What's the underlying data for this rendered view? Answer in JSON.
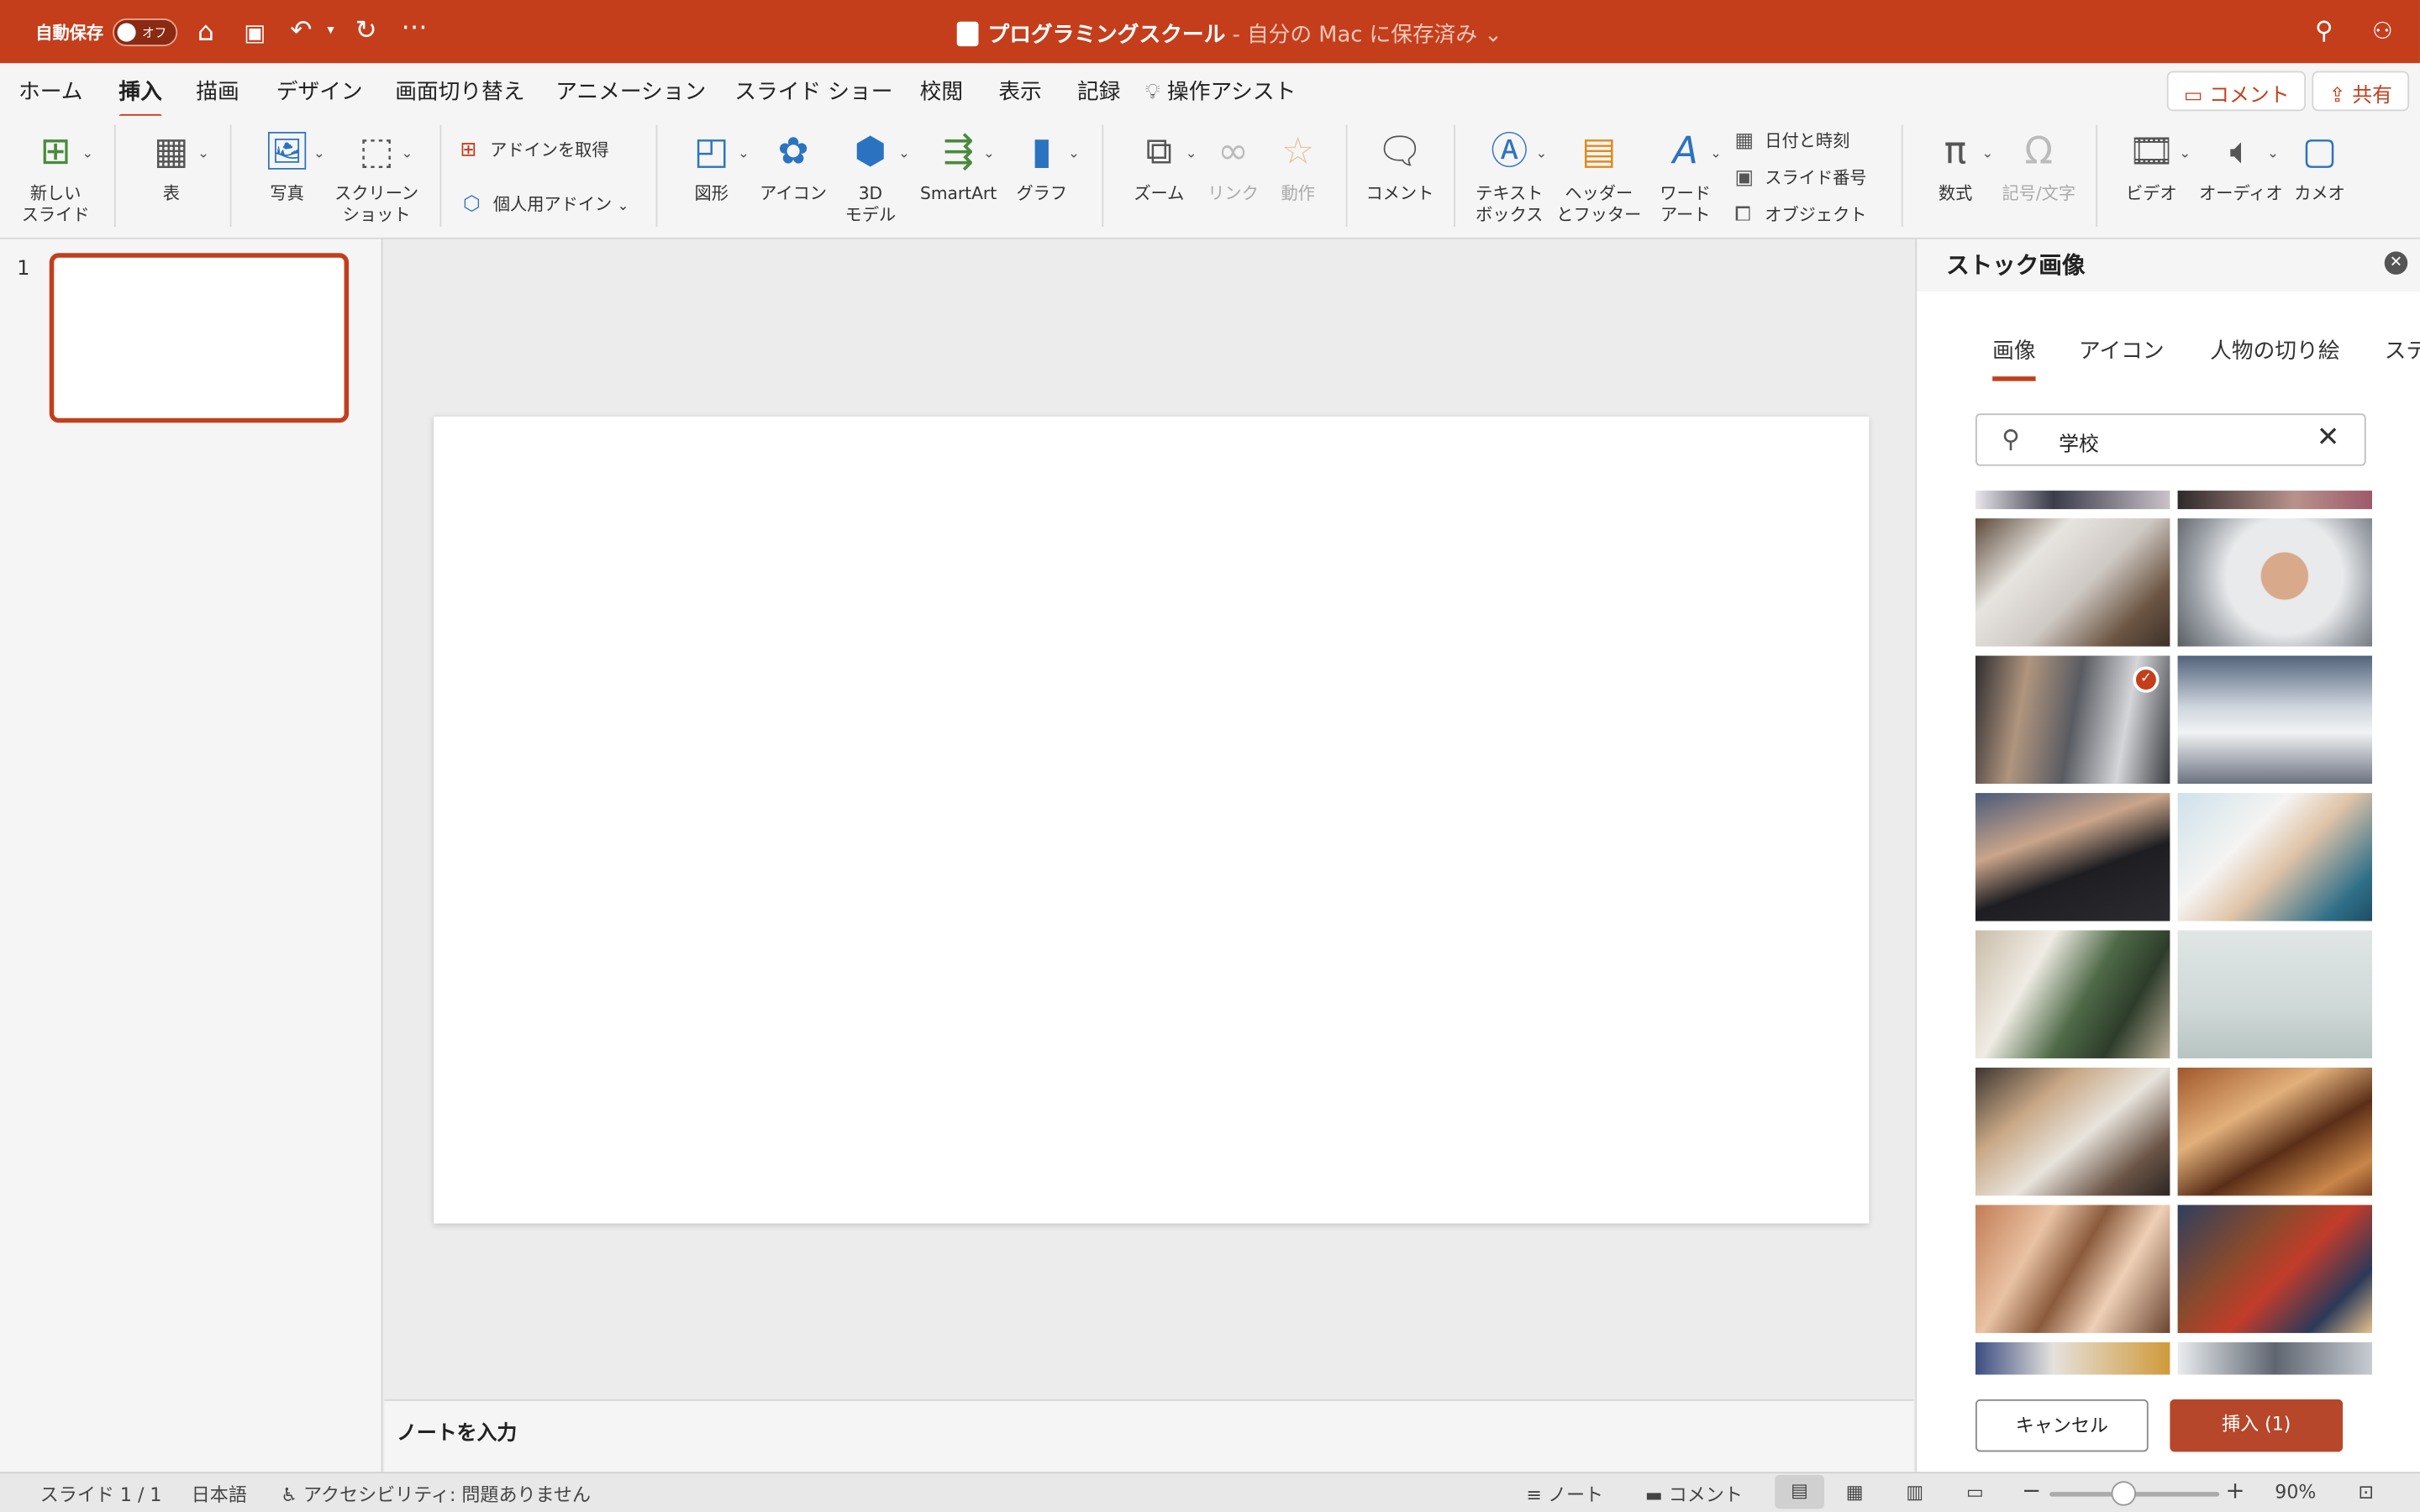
{
  "titlebar": {
    "autosave_label": "自動保存",
    "autosave_state": "オフ",
    "doc_title": "プログラミングスクール",
    "doc_status": " - 自分の Mac に保存済み",
    "brand_color": "#c43e1c"
  },
  "tabs": [
    "ホーム",
    "挿入",
    "描画",
    "デザイン",
    "画面切り替え",
    "アニメーション",
    "スライド ショー",
    "校閲",
    "表示",
    "記録",
    "操作アシスト"
  ],
  "active_tab": "挿入",
  "header_buttons": {
    "comment": "コメント",
    "share": "共有"
  },
  "ribbon": {
    "new_slide": "新しい\nスライド",
    "table": "表",
    "photo": "写真",
    "screenshot": "スクリーン\nショット",
    "get_addins": "アドインを取得",
    "my_addins": "個人用アドイン",
    "shapes": "図形",
    "icons": "アイコン",
    "model3d": "3D\nモデル",
    "smartart": "SmartArt",
    "chart": "グラフ",
    "zoom": "ズーム",
    "link": "リンク",
    "action": "動作",
    "comment": "コメント",
    "textbox": "テキスト\nボックス",
    "header_footer": "ヘッダー\nとフッター",
    "wordart": "ワード\nアート",
    "date_time": "日付と時刻",
    "slide_number": "スライド番号",
    "object": "オブジェクト",
    "equation": "数式",
    "symbol": "記号/文字",
    "video": "ビデオ",
    "audio": "オーディオ",
    "cameo": "カメオ"
  },
  "slide_panel": {
    "slide_number": "1"
  },
  "notes": {
    "placeholder": "ノートを入力"
  },
  "pane": {
    "title": "ストック画像",
    "tabs": [
      "画像",
      "アイコン",
      "人物の切り絵",
      "ステ"
    ],
    "search_value": "学校",
    "cancel": "キャンセル",
    "insert": "挿入 (1)"
  },
  "status": {
    "slide": "スライド 1 / 1",
    "language": "日本語",
    "accessibility": "アクセシビリティ: 問題ありません",
    "notes": "ノート",
    "comments": "コメント",
    "zoom": "90%"
  }
}
